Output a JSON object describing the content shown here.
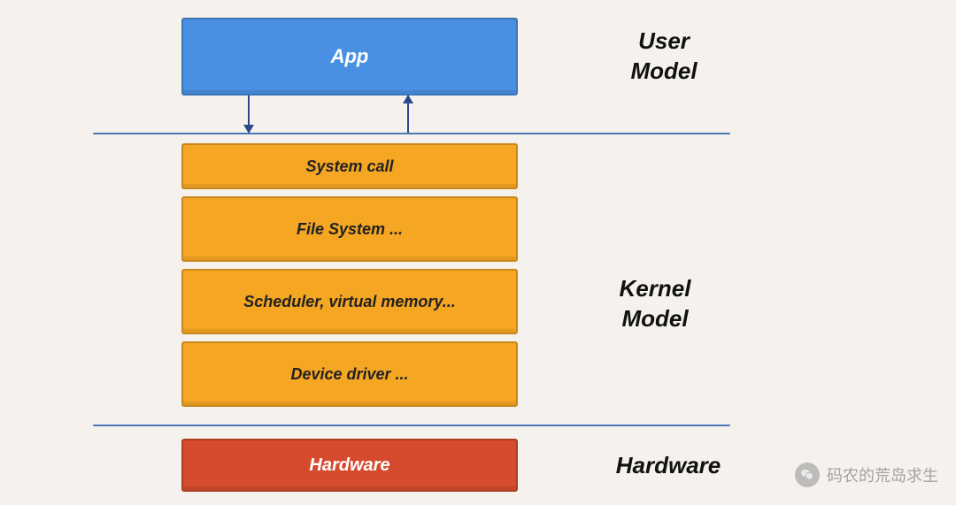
{
  "layers": {
    "app": "App",
    "system_call": "System call",
    "file_system": "File System ...",
    "scheduler": "Scheduler, virtual memory...",
    "device_driver": "Device driver ...",
    "hardware": "Hardware"
  },
  "labels": {
    "user_model_line1": "User",
    "user_model_line2": "Model",
    "kernel_model_line1": "Kernel",
    "kernel_model_line2": "Model",
    "hardware": "Hardware"
  },
  "watermark": {
    "text": "码农的荒岛求生"
  },
  "colors": {
    "app": "#4a90e2",
    "kernel": "#f5a623",
    "hardware": "#d64b2e",
    "divider": "#4a78b5",
    "bg": "#f5f2ed"
  }
}
